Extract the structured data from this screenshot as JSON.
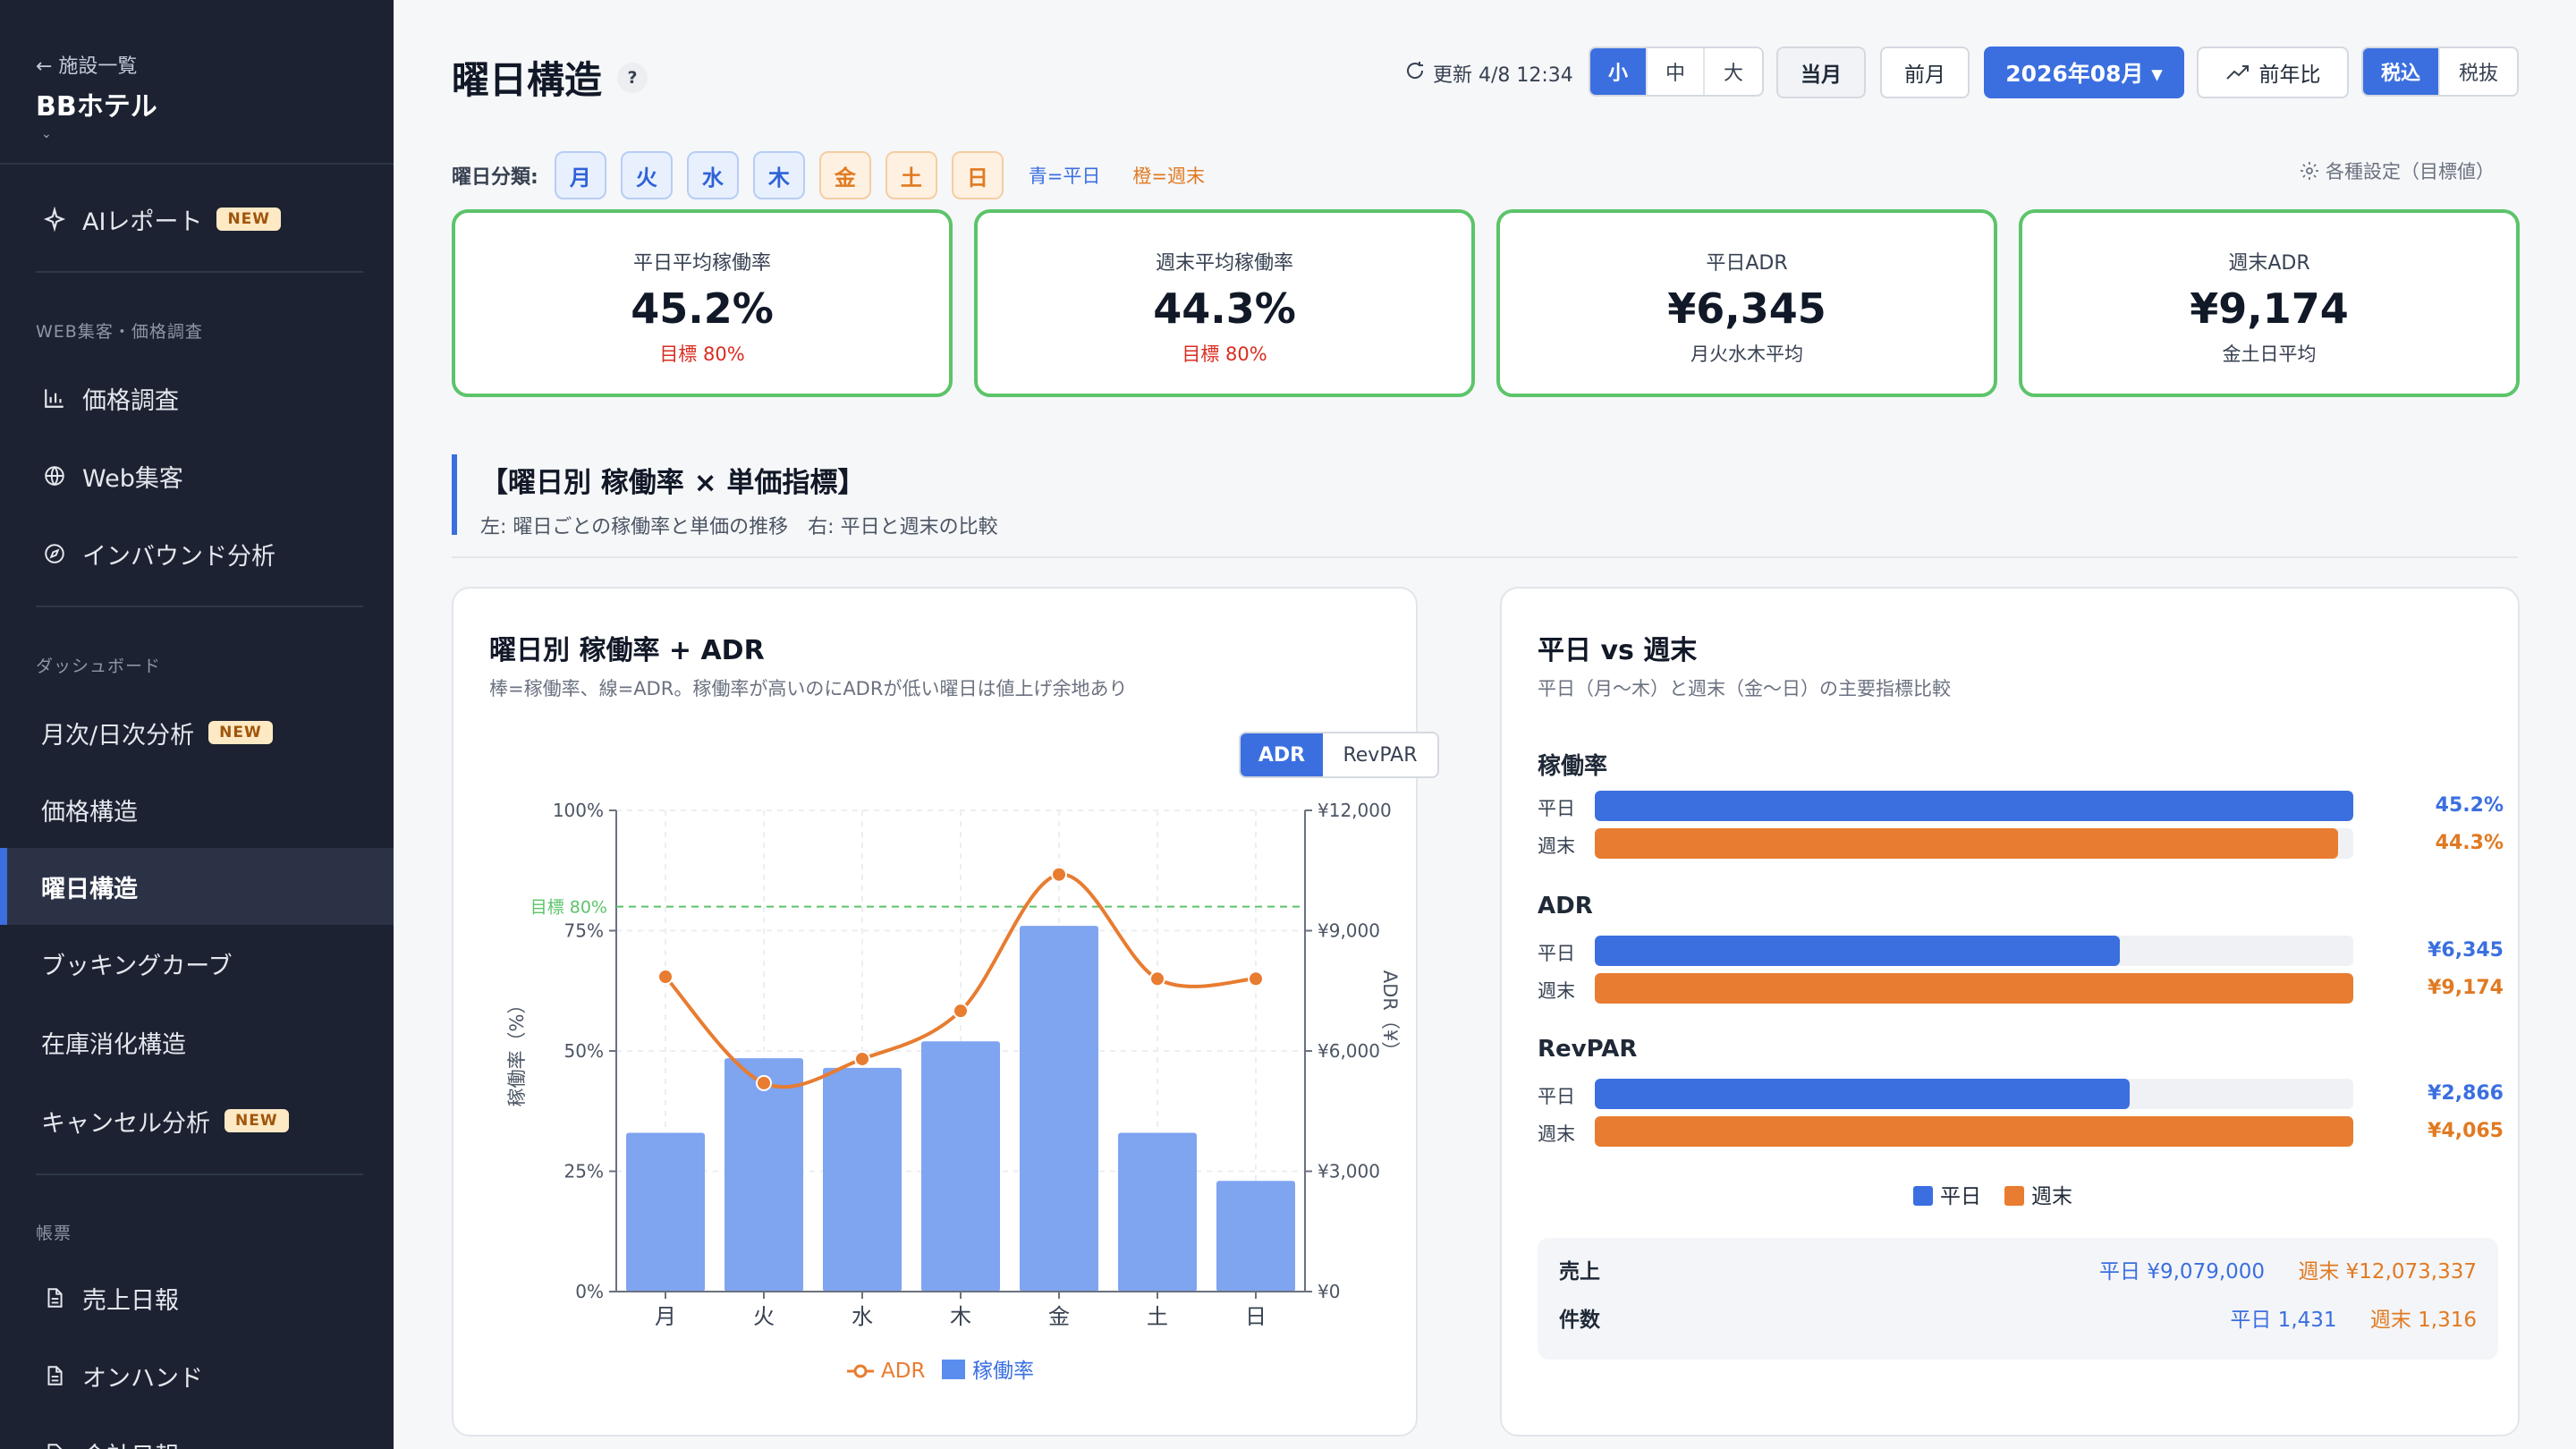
{
  "sidebar": {
    "back_label": "← 施設一覧",
    "hotel_name": "BBホテル",
    "caret": "⌄",
    "ai_report": "AIレポート",
    "new_badge": "NEW",
    "section_web": "WEB集客・価格調査",
    "price_survey": "価格調査",
    "web_marketing": "Web集客",
    "inbound": "インバウンド分析",
    "section_dashboard": "ダッシュボード",
    "monthly_daily": "月次/日次分析",
    "price_structure": "価格構造",
    "weekday_structure": "曜日構造",
    "booking_curve": "ブッキングカーブ",
    "inventory": "在庫消化構造",
    "cancel": "キャンセル分析",
    "section_reports": "帳票",
    "daily_sales": "売上日報",
    "on_hand": "オンハンド",
    "partial": "会計日報"
  },
  "header": {
    "title": "曜日構造",
    "help": "?",
    "updated": "更新 4/8 12:34",
    "size_options": [
      "小",
      "中",
      "大"
    ],
    "this_month": "当月",
    "prev_month": "前月",
    "month_select": "2026年08月 ▾",
    "yoy": "前年比",
    "tax_options": [
      "税込",
      "税抜"
    ]
  },
  "day_classification": {
    "label": "曜日分類:",
    "days": [
      "月",
      "火",
      "水",
      "木",
      "金",
      "土",
      "日"
    ],
    "legend_weekday": "青=平日",
    "legend_weekend": "橙=週末",
    "settings": "各種設定（目標値）"
  },
  "kpis": [
    {
      "label": "平日平均稼働率",
      "value": "45.2%",
      "sub": "目標 80%"
    },
    {
      "label": "週末平均稼働率",
      "value": "44.3%",
      "sub": "目標 80%"
    },
    {
      "label": "平日ADR",
      "value": "¥6,345",
      "sub": "月火水木平均"
    },
    {
      "label": "週末ADR",
      "value": "¥9,174",
      "sub": "金土日平均"
    }
  ],
  "section": {
    "title": "【曜日別 稼働率 × 単価指標】",
    "subtitle": "左: 曜日ごとの稼働率と単価の推移　右: 平日と週末の比較"
  },
  "left_card": {
    "title": "曜日別 稼働率 + ADR",
    "subtitle": "棒=稼働率、線=ADR。稼働率が高いのにADRが低い曜日は値上げ余地あり",
    "toggle": [
      "ADR",
      "RevPAR"
    ]
  },
  "chart_data": {
    "type": "bar",
    "categories": [
      "月",
      "火",
      "水",
      "木",
      "金",
      "土",
      "日"
    ],
    "series": [
      {
        "name": "稼働率",
        "type": "bar",
        "axis": "left",
        "values": [
          33,
          48.5,
          46.5,
          52,
          76,
          33,
          23
        ]
      },
      {
        "name": "ADR",
        "type": "line",
        "axis": "right",
        "values": [
          7850,
          5200,
          5800,
          7000,
          10400,
          7800,
          7800
        ]
      }
    ],
    "ylabel": "稼働率（%）",
    "y2label": "ADR（¥）",
    "ylim": [
      0,
      100
    ],
    "y2lim": [
      0,
      12000
    ],
    "yticks": [
      "0%",
      "25%",
      "50%",
      "75%",
      "100%"
    ],
    "y2ticks": [
      "¥0",
      "¥3,000",
      "¥6,000",
      "¥9,000",
      "¥12,000"
    ],
    "target_value": 80,
    "target_label": "目標 80%",
    "legend": [
      "ADR",
      "稼働率"
    ],
    "colors": {
      "bar": "#7fa4f0",
      "line": "#e87c30",
      "target": "#5cc46a"
    }
  },
  "right_card": {
    "title": "平日 vs 週末",
    "subtitle": "平日（月〜木）と週末（金〜日）の主要指標比較",
    "groups": [
      {
        "title": "稼働率",
        "rows": [
          {
            "label": "平日",
            "fraction": 1.0,
            "value": "45.2%"
          },
          {
            "label": "週末",
            "fraction": 0.98,
            "value": "44.3%"
          }
        ]
      },
      {
        "title": "ADR",
        "rows": [
          {
            "label": "平日",
            "fraction": 0.692,
            "value": "¥6,345"
          },
          {
            "label": "週末",
            "fraction": 1.0,
            "value": "¥9,174"
          }
        ]
      },
      {
        "title": "RevPAR",
        "rows": [
          {
            "label": "平日",
            "fraction": 0.705,
            "value": "¥2,866"
          },
          {
            "label": "週末",
            "fraction": 1.0,
            "value": "¥4,065"
          }
        ]
      }
    ],
    "legend": [
      "平日",
      "週末"
    ],
    "summary": [
      {
        "label": "売上",
        "weekday": "平日 ¥9,079,000",
        "weekend": "週末 ¥12,073,337"
      },
      {
        "label": "件数",
        "weekday": "平日 1,431",
        "weekend": "週末 1,316"
      }
    ]
  },
  "colors": {
    "accent": "#3b6fe0",
    "weekend": "#e87c30",
    "kpi_border": "#5cc46a",
    "sidebar_bg": "#1c2231"
  }
}
